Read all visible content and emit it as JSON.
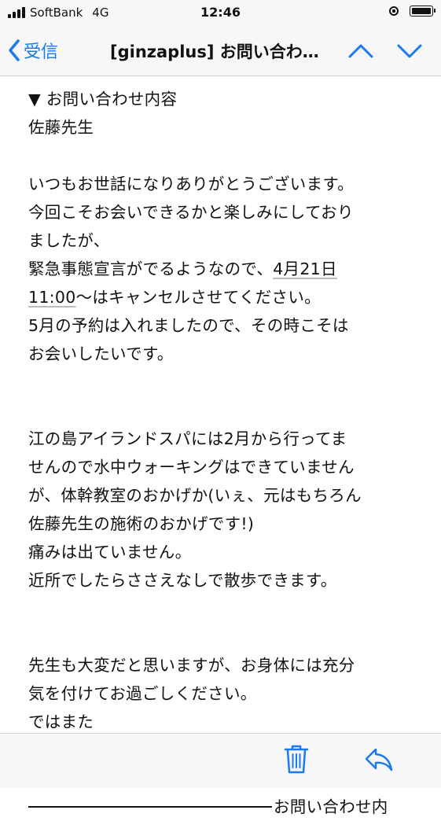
{
  "status_bar": {
    "carrier": "SoftBank",
    "network": "4G",
    "time": "12:46"
  },
  "nav": {
    "back_label": "受信",
    "title": "[ginzaplus] お問い合わ…",
    "accent_color": "#1a7bf0"
  },
  "body": {
    "heading": "▼ お問い合わせ内容",
    "greeting": "佐藤先生",
    "p1": [
      "いつもお世話になりありがとうございます。",
      "今回こそお会いできるかと楽しみにしておりましたが、"
    ],
    "p1_line2a": "今回こそお会いできるかと楽しみにしており",
    "p1_line2b": "ましたが、",
    "p1_line3_pre": "緊急事態宣言がでるようなので、",
    "p1_line3_date": "4月21日",
    "p1_line4_time": "11:00",
    "p1_line4_post": "〜はキャンセルさせてください。",
    "p1_line5": "5月の予約は入れましたので、その時こそは",
    "p1_line6": "お会いしたいです。",
    "p2_line1": "江の島アイランドスパには2月から行ってま",
    "p2_line2": "せんので水中ウォーキングはできていません",
    "p2_line3": "が、体幹教室のおかげか(いぇ、元はもちろん",
    "p2_line4": "佐藤先生の施術のおかげです!)",
    "p2_line5": "痛みは出ていません。",
    "p2_line6": "近所でしたらささえなしで散歩できます。",
    "p3_line1": "先生も大変だと思いますが、お身体には充分",
    "p3_line2": "気を付けてお過ごしください。",
    "p3_line3": "ではまた",
    "signature_tail": "お問い合わせ内"
  },
  "toolbar": {
    "trash_icon": "trash-icon",
    "reply_icon": "reply-icon"
  }
}
